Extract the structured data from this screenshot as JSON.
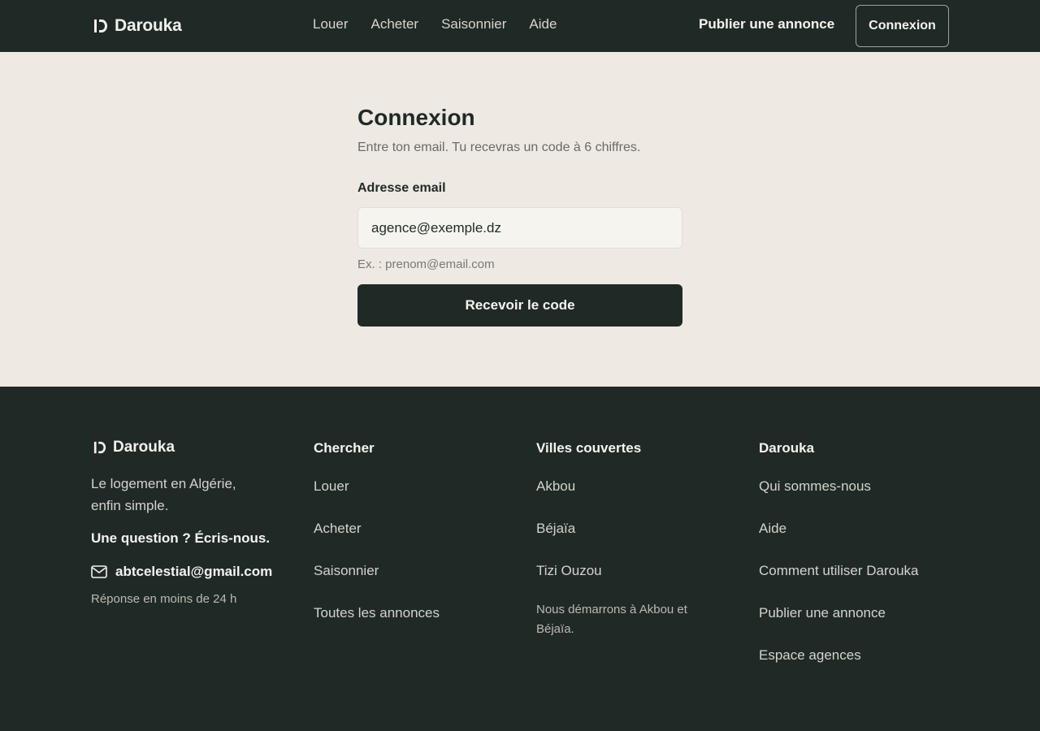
{
  "header": {
    "brand": "Darouka",
    "nav": [
      "Louer",
      "Acheter",
      "Saisonnier",
      "Aide"
    ],
    "publish_label": "Publier une annonce",
    "login_label": "Connexion"
  },
  "login_form": {
    "title": "Connexion",
    "subtitle": "Entre ton email. Tu recevras un code à 6 chiffres.",
    "email_label": "Adresse email",
    "email_value": "agence@exemple.dz",
    "email_hint": "Ex. : prenom@email.com",
    "submit_label": "Recevoir le code"
  },
  "footer": {
    "brand": "Darouka",
    "tagline": "Le logement en Algérie, enfin simple.",
    "contact_heading": "Une question ? Écris-nous.",
    "contact_email": "abtcelestial@gmail.com",
    "reply_time": "Réponse en moins de 24 h",
    "columns": [
      {
        "heading": "Chercher",
        "links": [
          "Louer",
          "Acheter",
          "Saisonnier",
          "Toutes les annonces"
        ]
      },
      {
        "heading": "Villes couvertes",
        "links": [
          "Akbou",
          "Béjaïa",
          "Tizi Ouzou"
        ],
        "note": "Nous démarrons à Akbou et Béjaïa."
      },
      {
        "heading": "Darouka",
        "links": [
          "Qui sommes-nous",
          "Aide",
          "Comment utiliser Darouka",
          "Publier une annonce",
          "Espace agences"
        ]
      }
    ]
  },
  "colors": {
    "dark": "#1f2a27",
    "background": "#eee9e2",
    "input_bg": "#f6f4ef"
  },
  "icons": [
    "darouka-logo-icon",
    "mail-icon"
  ]
}
